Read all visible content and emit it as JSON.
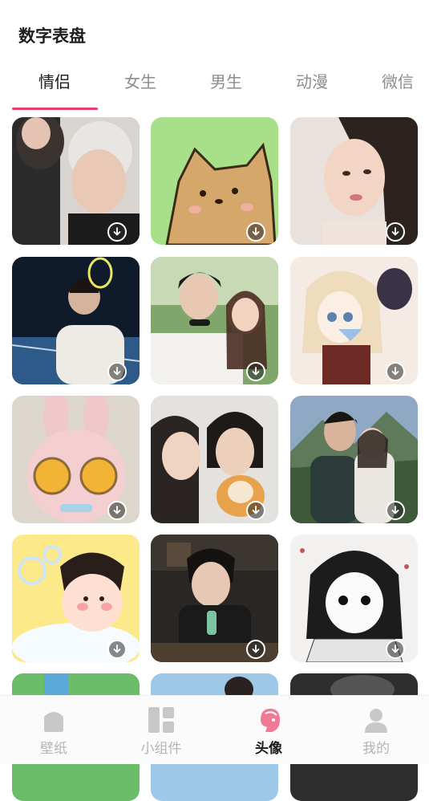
{
  "header": {
    "title": "数字表盘"
  },
  "tabs": [
    {
      "label": "情侣",
      "active": true
    },
    {
      "label": "女生",
      "active": false
    },
    {
      "label": "男生",
      "active": false
    },
    {
      "label": "动漫",
      "active": false
    },
    {
      "label": "微信",
      "active": false
    }
  ],
  "grid": {
    "download_icon": "download-circle-icon",
    "cards": [
      {
        "subject": "couple-photo-1"
      },
      {
        "subject": "cartoon-dog"
      },
      {
        "subject": "woman-portrait"
      },
      {
        "subject": "tennis-boy"
      },
      {
        "subject": "couple-photo-2"
      },
      {
        "subject": "anime-girl"
      },
      {
        "subject": "plush-bunny-sunglasses"
      },
      {
        "subject": "couple-with-dog"
      },
      {
        "subject": "couple-mountains"
      },
      {
        "subject": "cartoon-boy-bath"
      },
      {
        "subject": "boy-drinking"
      },
      {
        "subject": "manga-girl"
      },
      {
        "subject": "partial-1"
      },
      {
        "subject": "partial-2"
      },
      {
        "subject": "partial-3"
      }
    ]
  },
  "bottom_nav": [
    {
      "label": "壁纸",
      "icon": "wallpaper-icon",
      "active": false
    },
    {
      "label": "小组件",
      "icon": "widget-icon",
      "active": false
    },
    {
      "label": "头像",
      "icon": "avatar-head-icon",
      "active": true
    },
    {
      "label": "我的",
      "icon": "profile-icon",
      "active": false
    }
  ],
  "colors": {
    "accent": "#e4406e",
    "inactive": "#b5b5b5"
  }
}
